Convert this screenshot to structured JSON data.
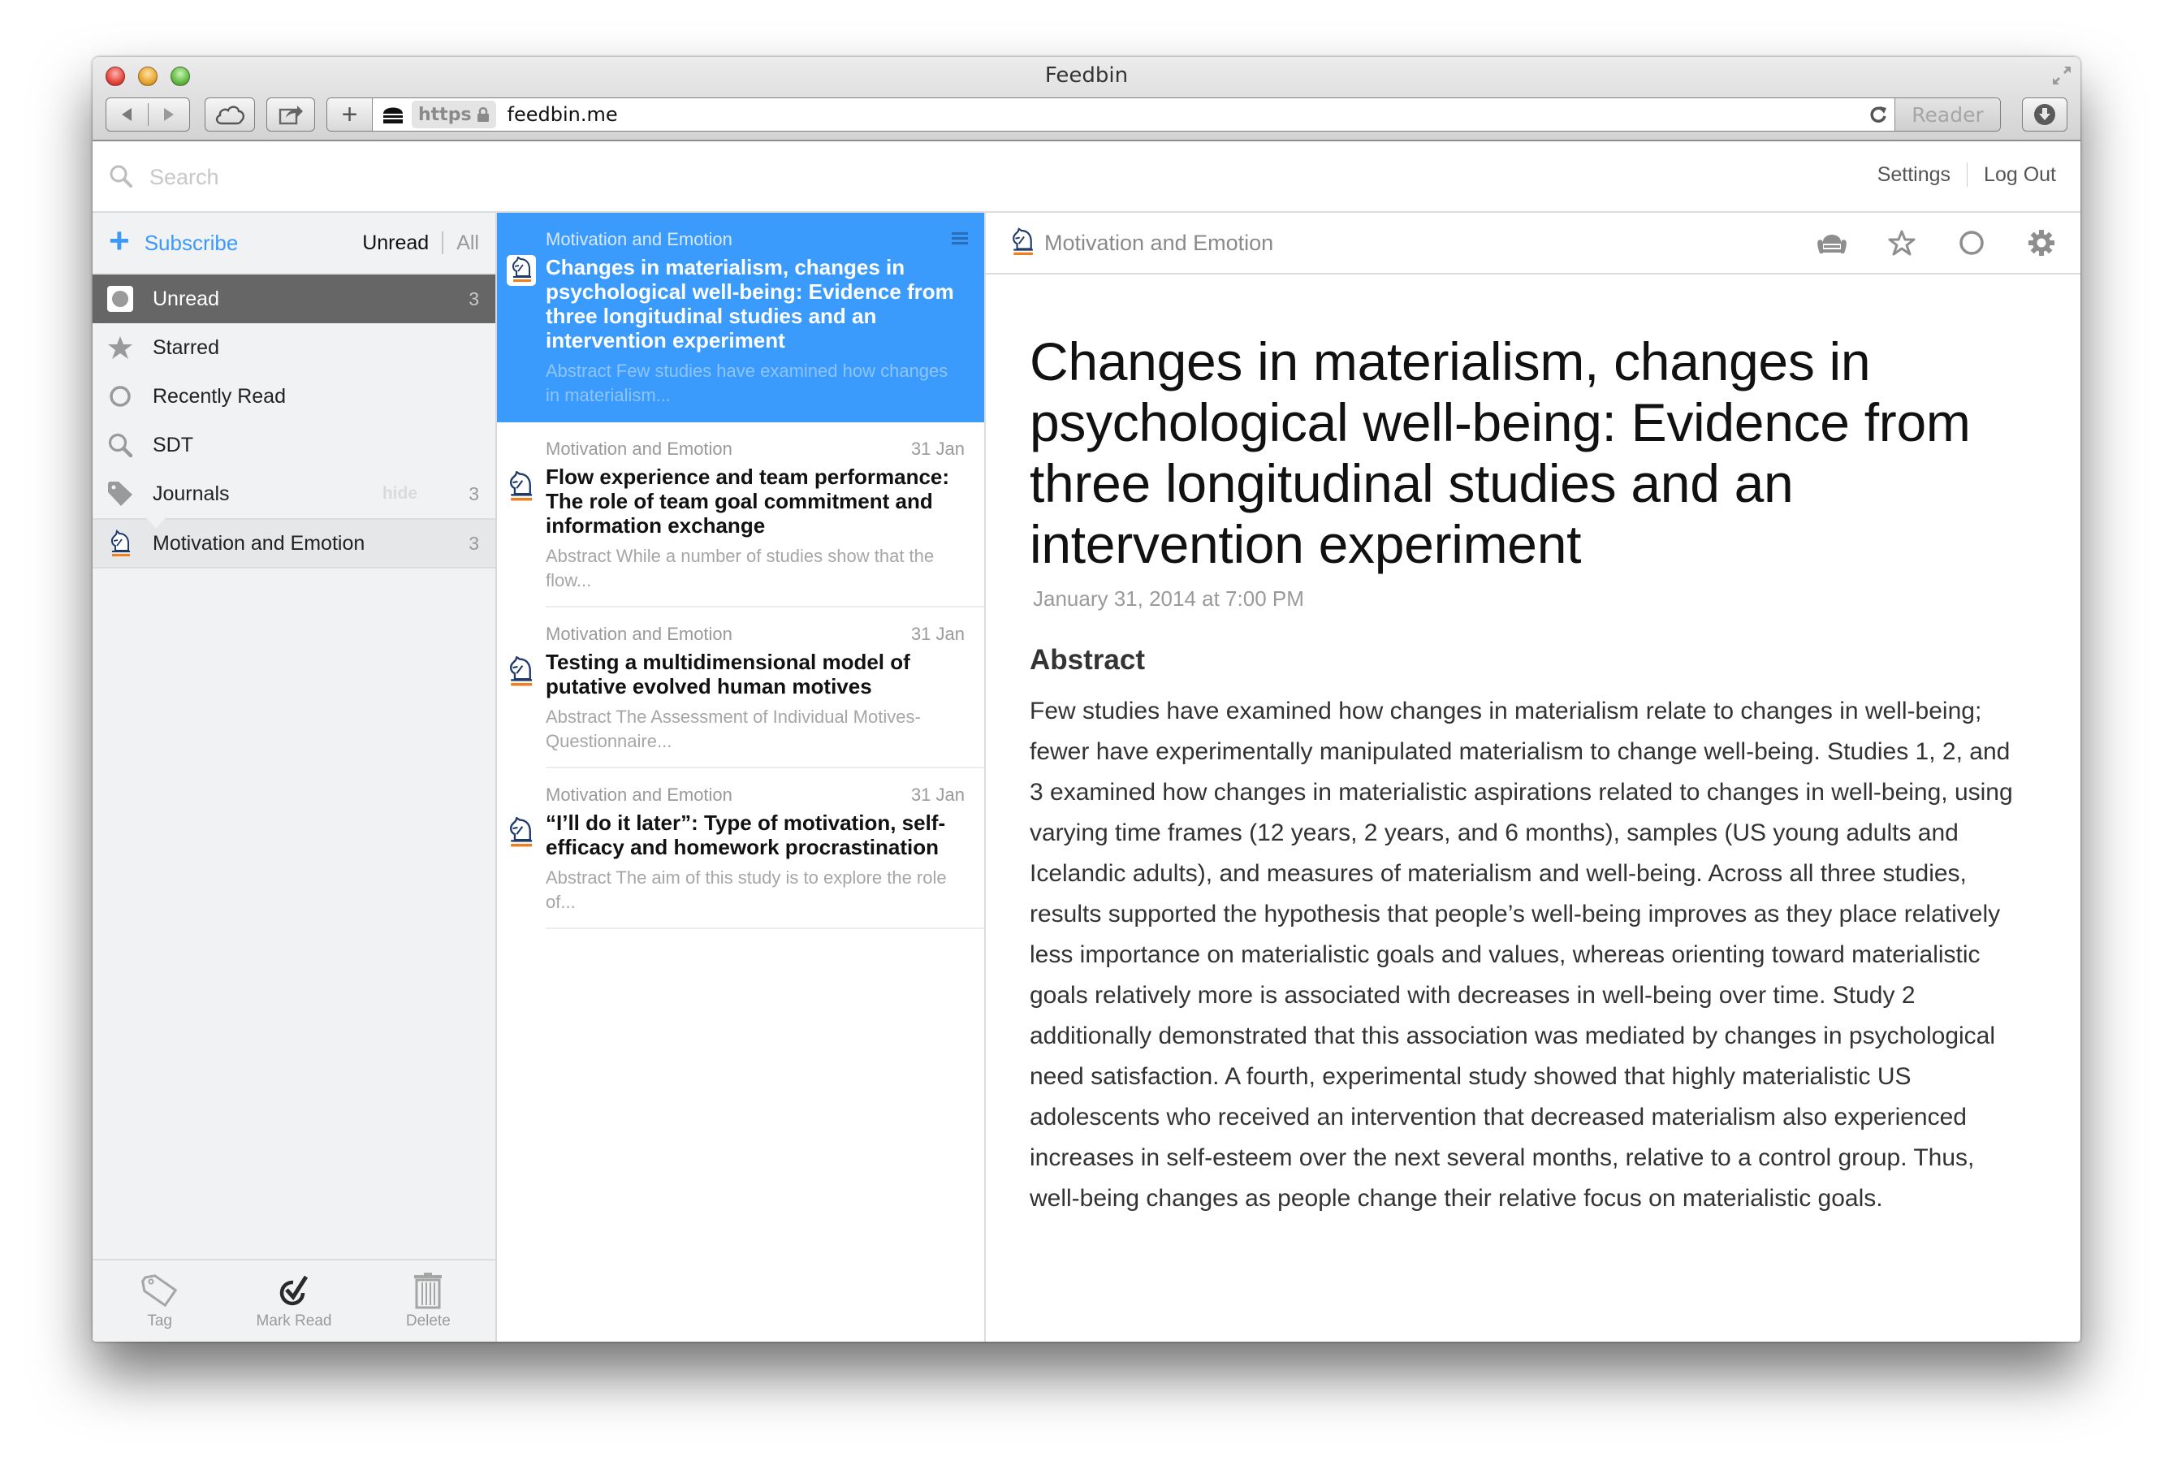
{
  "browser": {
    "window_title": "Feedbin",
    "https_label": "https",
    "url": "feedbin.me",
    "reader_label": "Reader",
    "new_tab_label": "+"
  },
  "header": {
    "search_placeholder": "Search",
    "settings_label": "Settings",
    "logout_label": "Log Out"
  },
  "sidebar": {
    "subscribe_label": "Subscribe",
    "filter_unread": "Unread",
    "filter_all": "All",
    "items": [
      {
        "label": "Unread",
        "count": "3",
        "icon": "unread-circle-icon",
        "selected": true
      },
      {
        "label": "Starred",
        "count": "",
        "icon": "star-icon"
      },
      {
        "label": "Recently Read",
        "count": "",
        "icon": "circle-icon"
      },
      {
        "label": "SDT",
        "count": "",
        "icon": "search-icon"
      },
      {
        "label": "Journals",
        "count": "3",
        "hide_label": "hide",
        "icon": "tag-icon"
      },
      {
        "label": "Motivation and Emotion",
        "count": "3",
        "icon": "springer-knight-icon"
      }
    ],
    "footer": {
      "tag_label": "Tag",
      "mark_read_label": "Mark Read",
      "delete_label": "Delete"
    }
  },
  "entries": [
    {
      "feed": "Motivation and Emotion",
      "date": "",
      "title": "Changes in materialism, changes in psychological well-being: Evidence from three longitudinal studies and an intervention experiment",
      "summary": "Abstract Few studies have examined how changes in materialism...",
      "selected": true
    },
    {
      "feed": "Motivation and Emotion",
      "date": "31 Jan",
      "title": "Flow experience and team performance: The role of team goal commitment and information exchange",
      "summary": "Abstract While a number of studies show that the flow..."
    },
    {
      "feed": "Motivation and Emotion",
      "date": "31 Jan",
      "title": "Testing a multidimensional model of putative evolved human motives",
      "summary": "Abstract The Assessment of Individual Motives-Questionnaire..."
    },
    {
      "feed": "Motivation and Emotion",
      "date": "31 Jan",
      "title": "“I’ll do it later”: Type of motivation, self-efficacy and homework procrastination",
      "summary": "Abstract The aim of this study is to explore the role of..."
    }
  ],
  "article": {
    "feed_name": "Motivation and Emotion",
    "title": "Changes in materialism, changes in psychological well-being: Evidence from three longitudinal studies and an intervention experiment",
    "date": "January 31, 2014 at 7:00 PM",
    "section_heading": "Abstract",
    "body": "Few studies have examined how changes in materialism relate to changes in well-being; fewer have experimentally manipulated materialism to change well-being. Studies 1, 2, and 3 examined how changes in materialistic aspirations related to changes in well-being, using varying time frames (12 years, 2 years, and 6 months), samples (US young adults and Icelandic adults), and measures of materialism and well-being. Across all three studies, results supported the hypothesis that people’s well-being improves as they place relatively less importance on materialistic goals and values, whereas orienting toward materialistic goals relatively more is associated with decreases in well-being over time. Study 2 additionally demonstrated that this association was mediated by changes in psychological need satisfaction. A fourth, experimental study showed that highly materialistic US adolescents who received an intervention that decreased materialism also experienced increases in self-esteem over the next several months, relative to a control group. Thus, well-being changes as people change their relative focus on materialistic goals."
  },
  "colors": {
    "accent": "#3b9bfd",
    "sidebar_selected": "#666666",
    "sidebar_bg": "#f1f2f4",
    "feed_icon_underline": "#f07d1e",
    "feed_icon_navy": "#1d3a6b"
  }
}
